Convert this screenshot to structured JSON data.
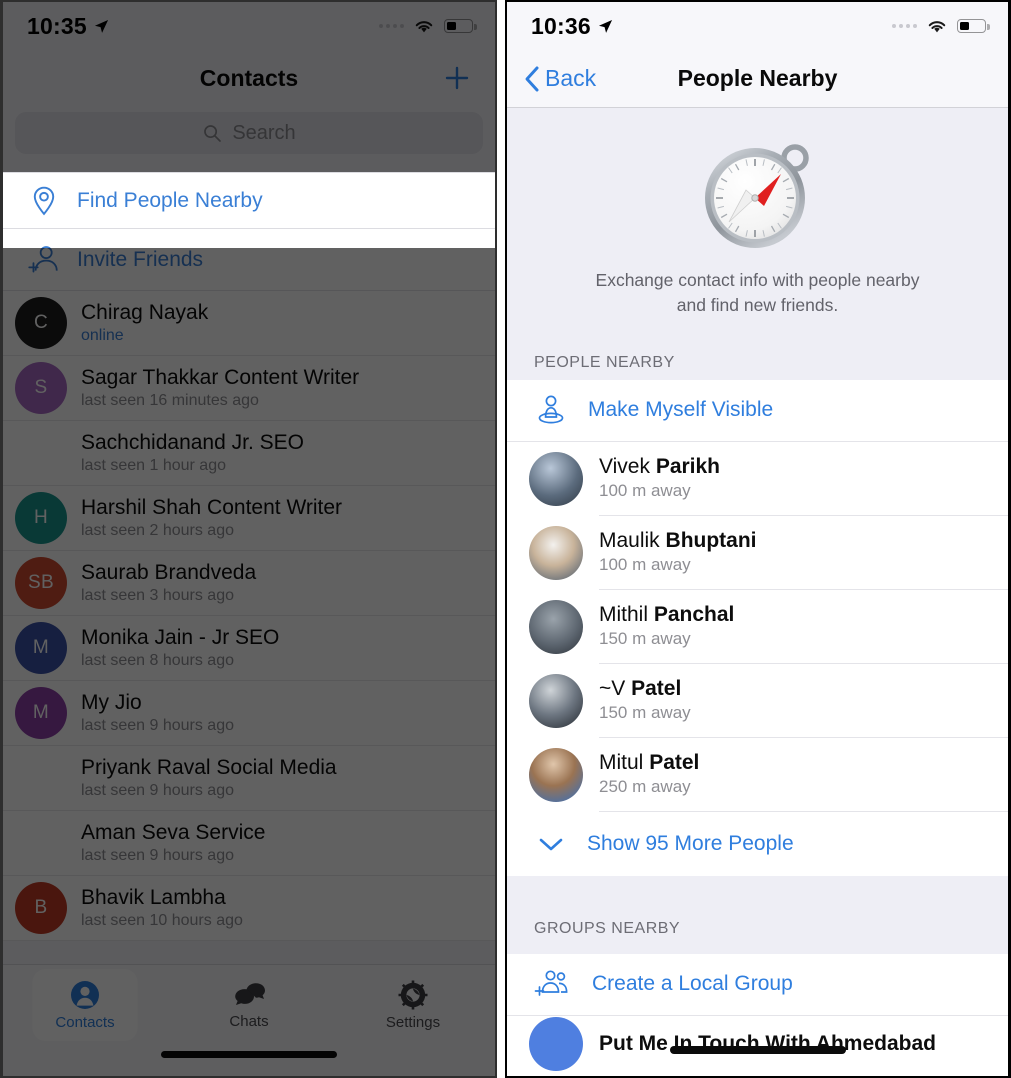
{
  "left_panel": {
    "status_bar": {
      "time": "10:35",
      "location_icon": "location-arrow-icon",
      "wifi_icon": "wifi-icon",
      "battery_icon": "battery-icon"
    },
    "nav": {
      "title": "Contacts",
      "add_button_icon": "plus-icon"
    },
    "search": {
      "placeholder": "Search",
      "icon": "search-icon"
    },
    "highlight_row": {
      "label": "Find People Nearby",
      "icon": "map-pin-icon"
    },
    "invite_row": {
      "label": "Invite Friends",
      "icon": "add-person-icon"
    },
    "contacts": [
      {
        "name": "Chirag Nayak",
        "status": "online",
        "online": true,
        "initials": "C",
        "color": "#1d1d1f"
      },
      {
        "name": "Sagar Thakkar Content Writer",
        "status": "last seen 16 minutes ago",
        "online": false,
        "initials": "S",
        "color": "#a96bc4"
      },
      {
        "name": "Sachchidanand Jr. SEO",
        "status": "last seen 1 hour ago",
        "online": false,
        "initials": "",
        "color": ""
      },
      {
        "name": "Harshil Shah Content Writer",
        "status": "last seen 2 hours ago",
        "online": false,
        "initials": "H",
        "color": "#18958f"
      },
      {
        "name": "Saurab Brandveda",
        "status": "last seen 3 hours ago",
        "online": false,
        "initials": "SB",
        "color": "#d04a30"
      },
      {
        "name": "Monika Jain - Jr SEO",
        "status": "last seen 8 hours ago",
        "online": false,
        "initials": "M",
        "color": "#3b52a8"
      },
      {
        "name": "My Jio",
        "status": "last seen 9 hours ago",
        "online": false,
        "initials": "M",
        "color": "#8e3fa8"
      },
      {
        "name": "Priyank Raval Social Media",
        "status": "last seen 9 hours ago",
        "online": false,
        "initials": "",
        "color": ""
      },
      {
        "name": "Aman Seva Service",
        "status": "last seen 9 hours ago",
        "online": false,
        "initials": "",
        "color": ""
      },
      {
        "name": "Bhavik Lambha",
        "status": "last seen 10 hours ago",
        "online": false,
        "initials": "B",
        "color": "#c23c25"
      }
    ],
    "tabs": [
      {
        "label": "Contacts",
        "icon": "person-icon",
        "active": true
      },
      {
        "label": "Chats",
        "icon": "chat-bubbles-icon",
        "active": false
      },
      {
        "label": "Settings",
        "icon": "gear-icon",
        "active": false
      }
    ]
  },
  "right_panel": {
    "status_bar": {
      "time": "10:36",
      "location_icon": "location-arrow-icon",
      "wifi_icon": "wifi-icon",
      "battery_icon": "battery-icon"
    },
    "nav": {
      "back_label": "Back",
      "back_icon": "chevron-left-icon",
      "title": "People Nearby"
    },
    "hero": {
      "icon": "compass-icon",
      "description_line1": "Exchange contact info with people nearby",
      "description_line2": "and find new friends."
    },
    "people_section": {
      "header": "PEOPLE NEARBY",
      "make_visible": {
        "label": "Make Myself Visible",
        "icon": "visible-person-icon"
      },
      "people": [
        {
          "first": "Vivek ",
          "last": "Parikh",
          "distance": "100 m away",
          "avatar": "photo-sunglasses"
        },
        {
          "first": "Maulik ",
          "last": "Bhuptani",
          "distance": "100 m away",
          "avatar": "photo-suit"
        },
        {
          "first": "Mithil ",
          "last": "Panchal",
          "distance": "150 m away",
          "avatar": "photo-glasses"
        },
        {
          "first": "~V ",
          "last": "Patel",
          "distance": "150 m away",
          "avatar": "photo-dark"
        },
        {
          "first": "Mitul ",
          "last": "Patel",
          "distance": "250 m away",
          "avatar": "photo-blue"
        }
      ],
      "show_more": {
        "label": "Show 95 More People",
        "icon": "chevron-down-icon"
      }
    },
    "groups_section": {
      "header": "GROUPS NEARBY",
      "create_group": {
        "label": "Create a Local Group",
        "icon": "add-group-icon"
      },
      "groups": [
        {
          "name": "Put Me In Touch With Ahmedabad"
        }
      ]
    }
  },
  "colors": {
    "accent_blue": "#2f7ede",
    "link_blue": "#3a7fd5",
    "panel_bg": "#eeeef5",
    "secondary_text": "#8e8e93"
  }
}
